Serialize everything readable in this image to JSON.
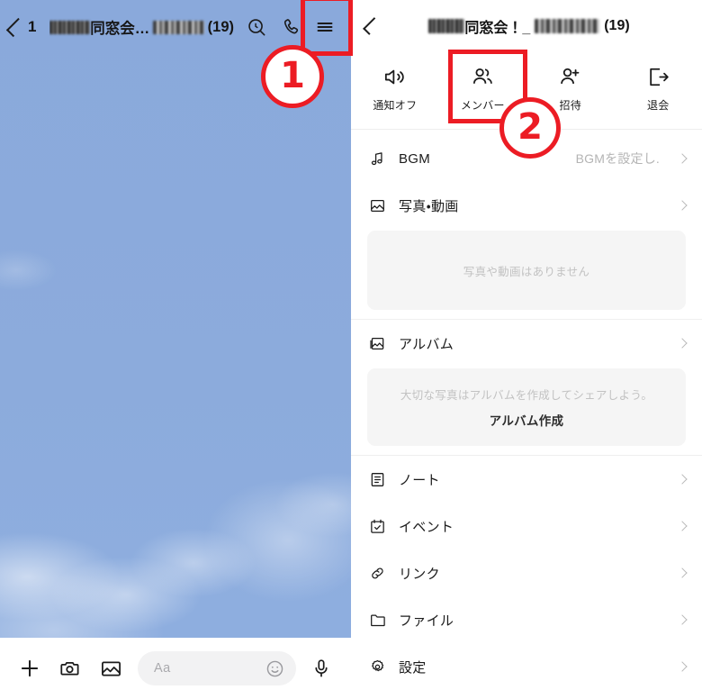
{
  "chat": {
    "header": {
      "back_icon": "chevron-left-icon",
      "unread_count": "1",
      "title_visible": "同窓会…",
      "title_suffix": "(19)",
      "search_icon": "search-clock-icon",
      "call_icon": "phone-icon",
      "menu_icon": "hamburger-menu-icon"
    },
    "bottom_bar": {
      "plus_icon": "plus-icon",
      "camera_icon": "camera-icon",
      "gallery_icon": "image-icon",
      "input_placeholder": "Aa",
      "input_value": "",
      "emoji_icon": "smiley-icon",
      "mic_icon": "microphone-icon"
    },
    "background_color": "#8cabdc"
  },
  "menu": {
    "header": {
      "back_icon": "chevron-left-icon",
      "title_visible": "同窓会！_",
      "title_suffix": "(19)"
    },
    "actions": [
      {
        "label": "通知オフ",
        "icon": "speaker-mute-icon"
      },
      {
        "label": "メンバー",
        "icon": "members-icon"
      },
      {
        "label": "招待",
        "icon": "person-add-icon"
      },
      {
        "label": "退会",
        "icon": "exit-icon"
      }
    ],
    "rows": [
      {
        "label": "BGM",
        "icon": "music-note-icon",
        "value": "BGMを設定し."
      },
      {
        "label": "写真・動画",
        "icon": "photo-icon",
        "value": ""
      },
      {
        "label": "アルバム",
        "icon": "album-icon",
        "value": ""
      },
      {
        "label": "ノート",
        "icon": "note-icon",
        "value": ""
      },
      {
        "label": "イベント",
        "icon": "calendar-check-icon",
        "value": ""
      },
      {
        "label": "リンク",
        "icon": "link-icon",
        "value": ""
      },
      {
        "label": "ファイル",
        "icon": "folder-icon",
        "value": ""
      },
      {
        "label": "設定",
        "icon": "gear-icon",
        "value": ""
      }
    ],
    "photo_empty": {
      "text": "写真や動画はありません"
    },
    "album_empty": {
      "text": "大切な写真はアルバムを作成してシェアしよう。",
      "action": "アルバム作成"
    }
  },
  "annotations": {
    "accent_color": "#ec1c24",
    "step_one": "1",
    "step_two": "2"
  }
}
